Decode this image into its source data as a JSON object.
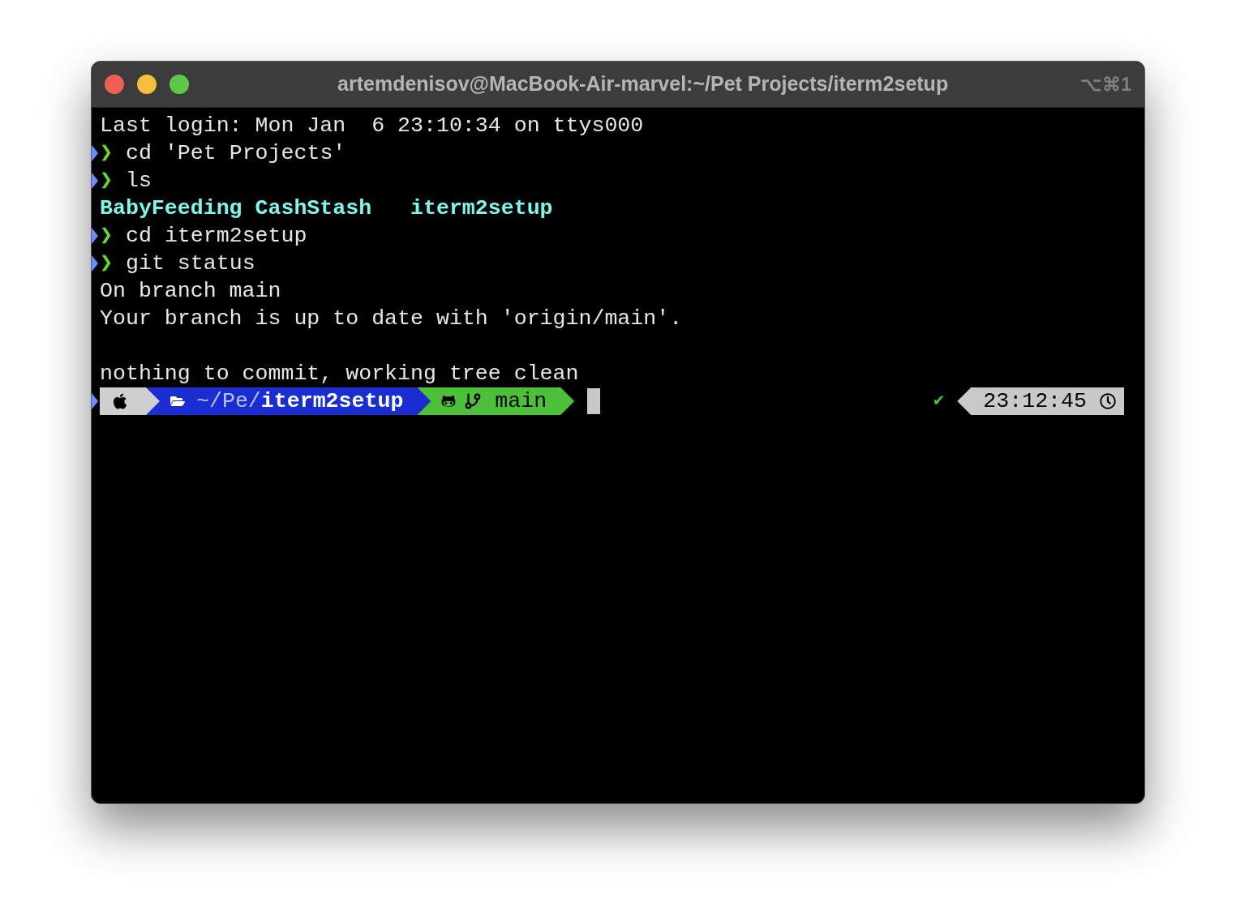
{
  "window": {
    "title": "artemdenisov@MacBook-Air-marvel:~/Pet Projects/iterm2setup",
    "shortcut": "⌥⌘1"
  },
  "terminal": {
    "lines": [
      {
        "kind": "output",
        "text": "Last login: Mon Jan  6 23:10:34 on ttys000"
      },
      {
        "kind": "command",
        "prompt": "❯",
        "text": "cd 'Pet Projects'"
      },
      {
        "kind": "command",
        "prompt": "❯",
        "text": "ls"
      },
      {
        "kind": "listing",
        "text": "BabyFeeding CashStash   iterm2setup"
      },
      {
        "kind": "command",
        "prompt": "❯",
        "text": "cd iterm2setup"
      },
      {
        "kind": "command",
        "prompt": "❯",
        "text": "git status"
      },
      {
        "kind": "output",
        "text": "On branch main"
      },
      {
        "kind": "output",
        "text": "Your branch is up to date with 'origin/main'."
      },
      {
        "kind": "blank"
      },
      {
        "kind": "output",
        "text": "nothing to commit, working tree clean"
      }
    ],
    "prompt": {
      "left": [
        {
          "kind": "os",
          "color": "#cfcfcf"
        },
        {
          "kind": "path",
          "text": "~/Pe/**iterm2setup**",
          "color": "#1a2dd0"
        },
        {
          "kind": "git",
          "text": "main",
          "color": "#4dc03a"
        }
      ],
      "status": "✔",
      "right": [
        {
          "kind": "time",
          "text": "23:12:45",
          "color": "#c9c9c9"
        }
      ]
    }
  }
}
